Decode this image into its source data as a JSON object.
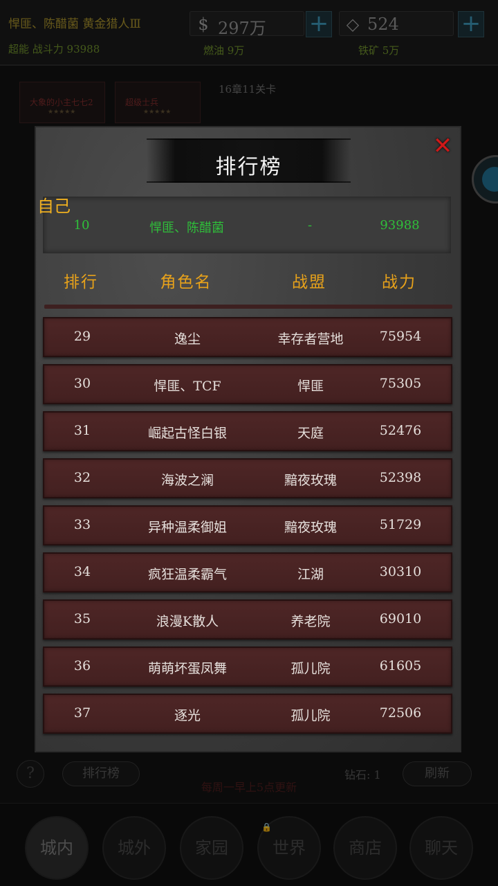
{
  "hud": {
    "player_name": "悍匪、陈醋菌 黄金猎人Ⅲ",
    "player_power": "超能 战斗力 93988",
    "currency": {
      "icon": "dollar-icon",
      "value": "297万"
    },
    "diamond": {
      "icon": "diamond-icon",
      "value": "524"
    },
    "plus_label": "+",
    "fuel": "燃油  9万",
    "iron": "铁矿  5万"
  },
  "formation": {
    "cards": [
      {
        "title": "大象的小主七七2",
        "stars": "★★★★★"
      },
      {
        "title": "超级士兵",
        "stars": "★★★★★"
      }
    ],
    "chapter": "16章11关卡"
  },
  "bottom_tools": {
    "help": "?",
    "ranking_button": "排行榜",
    "gems": "钻石: 1",
    "refresh_button": "刷新",
    "notice": "每周一早上5点更新"
  },
  "nav": [
    "城内",
    "城外",
    "家园",
    "世界",
    "商店",
    "聊天"
  ],
  "leaderboard": {
    "title": "排行榜",
    "close_label": "✕",
    "self_label": "自己",
    "self": {
      "rank": "10",
      "name": "悍匪、陈醋菌",
      "alliance": "-",
      "power": "93988"
    },
    "headers": {
      "rank": "排行",
      "name": "角色名",
      "alliance": "战盟",
      "power": "战力"
    },
    "rows": [
      {
        "rank": "29",
        "name": "逸尘",
        "alliance": "幸存者营地",
        "power": "75954"
      },
      {
        "rank": "30",
        "name": "悍匪、TCF",
        "alliance": "悍匪",
        "power": "75305"
      },
      {
        "rank": "31",
        "name": "崛起古怪白银",
        "alliance": "天庭",
        "power": "52476"
      },
      {
        "rank": "32",
        "name": "海波之澜",
        "alliance": "黯夜玫瑰",
        "power": "52398"
      },
      {
        "rank": "33",
        "name": "异种温柔御姐",
        "alliance": "黯夜玫瑰",
        "power": "51729"
      },
      {
        "rank": "34",
        "name": "疯狂温柔霸气",
        "alliance": "江湖",
        "power": "30310"
      },
      {
        "rank": "35",
        "name": "浪漫K散人",
        "alliance": "养老院",
        "power": "69010"
      },
      {
        "rank": "36",
        "name": "萌萌坏蛋凤舞",
        "alliance": "孤儿院",
        "power": "61605"
      },
      {
        "rank": "37",
        "name": "逐光",
        "alliance": "孤儿院",
        "power": "72506"
      }
    ]
  }
}
